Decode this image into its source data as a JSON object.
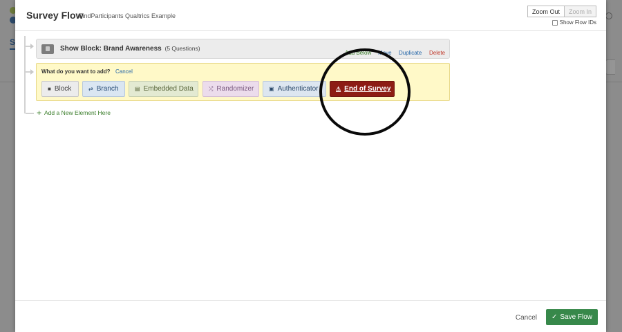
{
  "modal": {
    "title": "Survey Flow",
    "subtitle": "FindParticipants Qualtrics Example",
    "zoom_out": "Zoom Out",
    "zoom_in": "Zoom In",
    "show_flow_ids": "Show Flow IDs"
  },
  "background": {
    "tab_initial": "S"
  },
  "block": {
    "title": "Show Block: Brand Awareness",
    "question_count": "(5 Questions)",
    "actions": {
      "add_below": "Add Below",
      "move": "Move",
      "duplicate": "Duplicate",
      "delete": "Delete"
    }
  },
  "add_panel": {
    "prompt": "What do you want to add?",
    "cancel": "Cancel",
    "options": {
      "block": "Block",
      "branch": "Branch",
      "embedded": "Embedded Data",
      "randomizer": "Randomizer",
      "authenticator": "Authenticator",
      "end_of_survey": "End of Survey"
    }
  },
  "add_new_element": "Add a New Element Here",
  "footer": {
    "cancel": "Cancel",
    "save": "Save Flow"
  },
  "colors": {
    "accent_green": "#37884a",
    "end_of_survey_red": "#8d1c14",
    "link_blue": "#2566a8",
    "panel_yellow": "#fff9c8"
  }
}
